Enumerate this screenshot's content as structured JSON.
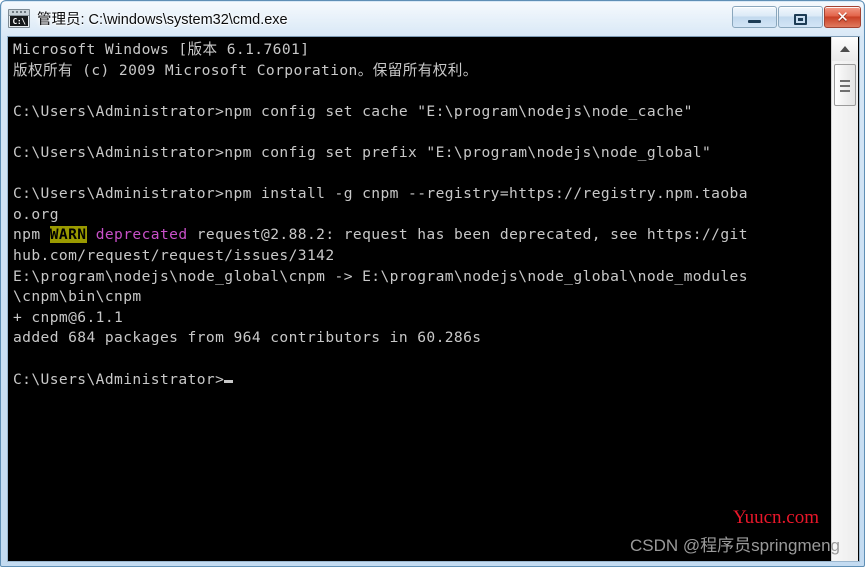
{
  "window": {
    "title": "管理员: C:\\windows\\system32\\cmd.exe",
    "icon_label": "C:\\",
    "icon_name": "cmd-icon",
    "controls": {
      "minimize_label": "Minimize",
      "maximize_label": "Maximize",
      "close_label": "✕"
    },
    "colors": {
      "frame": "#cfe2f4",
      "console_bg": "#000000",
      "console_fg": "#c8c8c8",
      "close_button": "#c93f25",
      "warn_bg": "#9a9a00",
      "magenta": "#c850c8",
      "watermark_red": "#e8172a"
    }
  },
  "console": {
    "lines": [
      {
        "text": "Microsoft Windows [版本 6.1.7601]"
      },
      {
        "text": "版权所有 (c) 2009 Microsoft Corporation。保留所有权利。"
      },
      {
        "text": ""
      },
      {
        "text": "C:\\Users\\Administrator>npm config set cache \"E:\\program\\nodejs\\node_cache\""
      },
      {
        "text": ""
      },
      {
        "text": "C:\\Users\\Administrator>npm config set prefix \"E:\\program\\nodejs\\node_global\""
      },
      {
        "text": ""
      },
      {
        "text": "C:\\Users\\Administrator>npm install -g cnpm --registry=https://registry.npm.taoba"
      },
      {
        "text": "o.org"
      },
      {
        "segments": [
          {
            "text": "npm ",
            "style": "normal"
          },
          {
            "text": "WARN",
            "style": "warn"
          },
          {
            "text": " ",
            "style": "normal"
          },
          {
            "text": "deprecated",
            "style": "magenta"
          },
          {
            "text": " request@2.88.2: request has been deprecated, see https://git",
            "style": "normal"
          }
        ]
      },
      {
        "text": "hub.com/request/request/issues/3142"
      },
      {
        "text": "E:\\program\\nodejs\\node_global\\cnpm -> E:\\program\\nodejs\\node_global\\node_modules"
      },
      {
        "text": "\\cnpm\\bin\\cnpm"
      },
      {
        "text": "+ cnpm@6.1.1"
      },
      {
        "text": "added 684 packages from 964 contributors in 60.286s"
      },
      {
        "text": ""
      },
      {
        "text": "C:\\Users\\Administrator>",
        "cursor": true
      }
    ]
  },
  "watermarks": {
    "red": "Yuucn.com",
    "csdn": "CSDN @程序员springmeng"
  },
  "scrollbar": {
    "up_arrow": "▲"
  }
}
